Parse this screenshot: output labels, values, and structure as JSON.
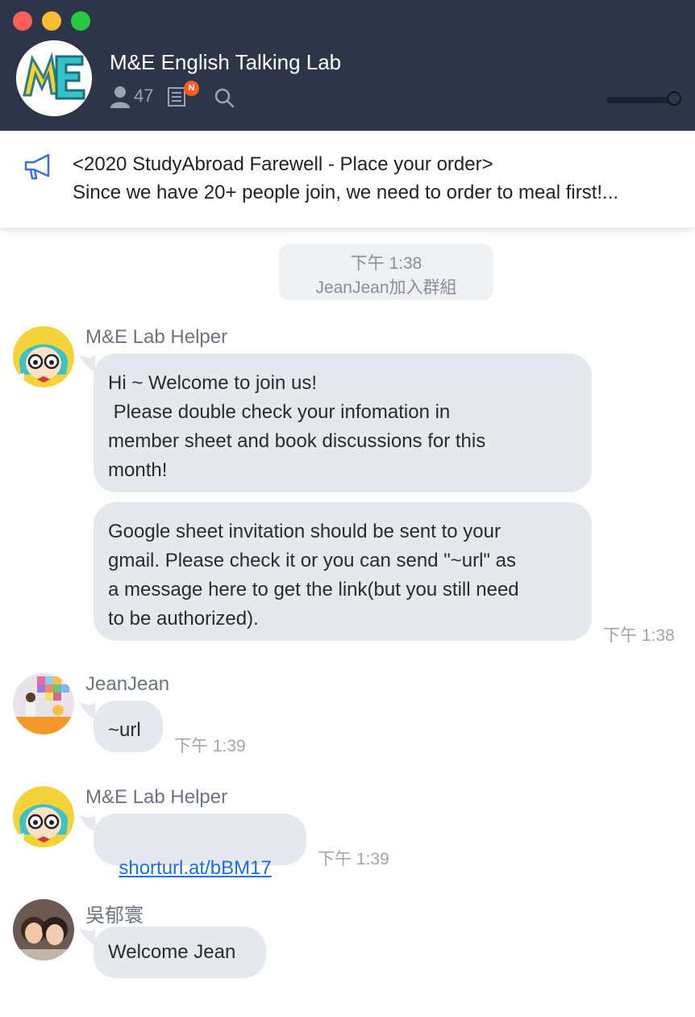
{
  "window": {
    "title": "M&E English Talking Lab"
  },
  "header": {
    "group_name": "M&E English Talking Lab",
    "member_count": "47",
    "notes_badge": "N",
    "icons": [
      "member-icon",
      "notes-icon",
      "search-icon"
    ],
    "zoom_level": 0.9
  },
  "announcement": {
    "icon": "megaphone-icon",
    "line1": "<2020 StudyAbroad Farewell - Place your order>",
    "line2": "Since we have 20+ people join, we need to order to meal first!..."
  },
  "system_message": {
    "time": "下午 1:38",
    "text": "JeanJean加入群組"
  },
  "messages": [
    {
      "sender": "M&E Lab Helper",
      "bubbles": [
        "Hi ~ Welcome to join us!\n Please double check your infomation in\nmember sheet and book discussions for this\nmonth!",
        "Google sheet invitation should be sent to your\ngmail. Please check it or you can send \"~url\" as\na message here to get the link(but you still need\nto be authorized)."
      ],
      "time": "下午 1:38"
    },
    {
      "sender": "JeanJean",
      "text": "~url",
      "time": "下午 1:39"
    },
    {
      "sender": "M&E Lab Helper",
      "link": "shorturl.at/bBM17",
      "time": "下午 1:39"
    },
    {
      "sender": "吳郁寰",
      "text": "Welcome Jean"
    }
  ],
  "colors": {
    "header_bg": "#2d3648",
    "bubble_bg": "#e5e8ec",
    "link": "#1a6ee6",
    "badge": "#ff5a1f"
  }
}
